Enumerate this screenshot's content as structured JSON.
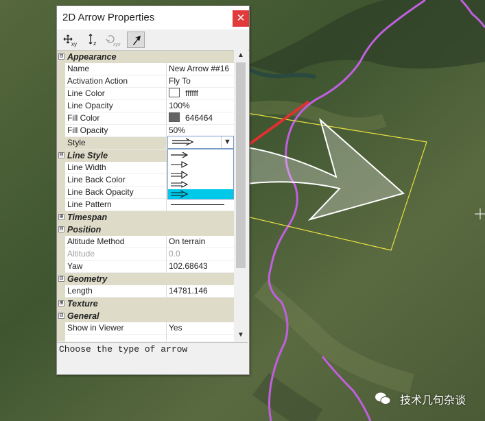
{
  "window": {
    "title": "2D Arrow Properties",
    "close_label": "✕"
  },
  "toolbar": {
    "buttons": [
      {
        "name": "move-xy",
        "label": "xy"
      },
      {
        "name": "move-z",
        "label": "z"
      },
      {
        "name": "rotate-xyz",
        "label": "xyz"
      },
      {
        "name": "edit-points",
        "label": ""
      }
    ]
  },
  "grid": {
    "rows": [
      {
        "type": "cat",
        "label": "Appearance",
        "exp": "⊟"
      },
      {
        "type": "prop",
        "label": "Name",
        "value": "New Arrow ##16"
      },
      {
        "type": "prop",
        "label": "Activation Action",
        "value": "Fly To"
      },
      {
        "type": "prop",
        "label": "Line Color",
        "value": "ffffff",
        "swatch": "#ffffff"
      },
      {
        "type": "prop",
        "label": "Line Opacity",
        "value": "100%"
      },
      {
        "type": "prop",
        "label": "Fill Color",
        "value": "646464",
        "swatch": "#646464"
      },
      {
        "type": "prop",
        "label": "Fill Opacity",
        "value": "50%"
      },
      {
        "type": "prop",
        "label": "Style",
        "value": "",
        "selected": true
      },
      {
        "type": "cat",
        "label": "Line Style",
        "exp": "⊟"
      },
      {
        "type": "prop",
        "label": "Line Width",
        "value": ""
      },
      {
        "type": "prop",
        "label": "Line Back Color",
        "value": ""
      },
      {
        "type": "prop",
        "label": "Line Back Opacity",
        "value": ""
      },
      {
        "type": "prop",
        "label": "Line Pattern",
        "value": ""
      },
      {
        "type": "cat",
        "label": "Timespan",
        "exp": "⊞"
      },
      {
        "type": "cat",
        "label": "Position",
        "exp": "⊟"
      },
      {
        "type": "prop",
        "label": "Altitude Method",
        "value": "On terrain"
      },
      {
        "type": "prop",
        "label": "Altitude",
        "value": "0.0",
        "disabled": true
      },
      {
        "type": "prop",
        "label": "Yaw",
        "value": "102.68643"
      },
      {
        "type": "cat",
        "label": "Geometry",
        "exp": "⊟"
      },
      {
        "type": "prop",
        "label": "Length",
        "value": "14781.146"
      },
      {
        "type": "cat",
        "label": "Texture",
        "exp": "⊞"
      },
      {
        "type": "cat",
        "label": "General",
        "exp": "⊟"
      },
      {
        "type": "prop",
        "label": "Show in Viewer",
        "value": "Yes"
      },
      {
        "type": "prop",
        "label": "",
        "value": ""
      }
    ]
  },
  "status_text": "Choose the type of arrow",
  "style_dropdown": {
    "options": 5,
    "selected_index": 4
  },
  "watermark": "技术几句杂谈",
  "colors": {
    "accent": "#00c8e8",
    "close": "#e23b3b",
    "category_bg": "#dedbc8",
    "boundary": "#c060e0",
    "arrow_annotation": "#e03030"
  }
}
